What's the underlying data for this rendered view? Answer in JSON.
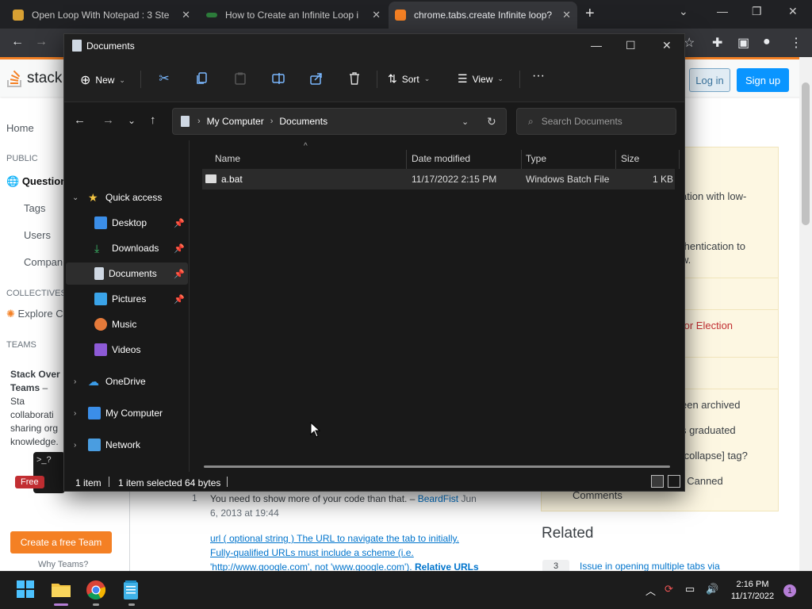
{
  "chrome": {
    "tabs": [
      {
        "title": "Open Loop With Notepad : 3 Ste",
        "color": "#d8a033"
      },
      {
        "title": "How to Create an Infinite Loop i",
        "color": "#2d7d3b"
      },
      {
        "title": "chrome.tabs.create Infinite loop?",
        "color": "#f48024"
      }
    ],
    "new_tab": "+"
  },
  "stackoverflow": {
    "logo_text": "stack",
    "login": "Log in",
    "signup": "Sign up",
    "nav": [
      "Home",
      "PUBLIC",
      "Question",
      "Tags",
      "Users",
      "Compan",
      "COLLECTIVES",
      "Explore C",
      "TEAMS"
    ],
    "teams_title": "Stack Over",
    "teams_title2": "Teams",
    "teams_dash": " – Sta",
    "teams_lines": [
      "collaborati",
      "sharing org",
      "knowledge."
    ],
    "free": "Free",
    "create_team": "Create a free Team",
    "why_teams": "Why Teams?",
    "right_texts": [
      "ation with low-",
      "thentication to",
      "w.",
      "tor Election",
      "een archived",
      "s graduated",
      "[collapse] tag?",
      ": Canned",
      "Comments"
    ],
    "comment_num": "1",
    "comment_text": "You need to show more of your code than that. –",
    "comment_user": "BeardFist",
    "comment_date": "Jun",
    "comment_date2": "6, 2013 at 19:44",
    "link_lines": [
      "url ( optional string ) The URL to navigate the tab to initially.",
      "Fully-qualified URLs must include a scheme (i.e.",
      "'http://www.google.com', not 'www.google.com').",
      "Relative URLs"
    ],
    "related": "Related",
    "related_num": "3",
    "related_item": "Issue in opening multiple tabs via"
  },
  "explorer": {
    "title": "Documents",
    "cmd": {
      "new": "New",
      "sort": "Sort",
      "view": "View",
      "more": "···"
    },
    "breadcrumb": [
      "My Computer",
      "Documents"
    ],
    "search_placeholder": "Search Documents",
    "sidebar": {
      "quick_access": "Quick access",
      "items": [
        "Desktop",
        "Downloads",
        "Documents",
        "Pictures",
        "Music",
        "Videos"
      ],
      "onedrive": "OneDrive",
      "my_computer": "My Computer",
      "network": "Network"
    },
    "columns": {
      "name": "Name",
      "date": "Date modified",
      "type": "Type",
      "size": "Size"
    },
    "files": [
      {
        "name": "a.bat",
        "date": "11/17/2022 2:15 PM",
        "type": "Windows Batch File",
        "size": "1 KB"
      }
    ],
    "status": {
      "count": "1 item",
      "selected": "1 item selected",
      "bytes": "64 bytes"
    }
  },
  "taskbar": {
    "time": "2:16 PM",
    "date": "11/17/2022",
    "notifications": "1"
  }
}
